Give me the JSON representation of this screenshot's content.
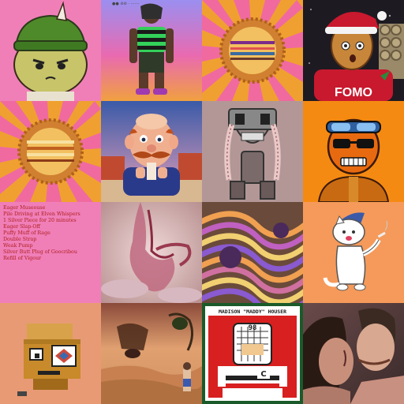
{
  "tiles": [
    {
      "id": 1,
      "subject": "green-beanie-unicorn-cat-icon"
    },
    {
      "id": 2,
      "subject": "striped-figure-icon",
      "caption": "●● ⊘⊘ · ·······"
    },
    {
      "id": 3,
      "subject": "sunburst-coin-icon"
    },
    {
      "id": 4,
      "subject": "gingerbread-santa-fomo-icon",
      "shirt_text": "FOMO"
    },
    {
      "id": 5,
      "subject": "sunburst-coin-icon"
    },
    {
      "id": 6,
      "subject": "chef-mustache-icon"
    },
    {
      "id": 7,
      "subject": "robot-creature-icon"
    },
    {
      "id": 8,
      "subject": "goggles-robot-icon"
    },
    {
      "id": 9,
      "subject": "text-list",
      "lines": [
        "Eager Museouse",
        "Pile Driving at Elven Whispers",
        "1 Silver Piece for 20 minutes",
        "Eager Slap-Off",
        "Puffy Muff of Rage",
        "Double Strap",
        "Weak Pump",
        "Silver Butt Plug of Goocribou",
        "Refill of Vigour"
      ]
    },
    {
      "id": 10,
      "subject": "abstract-pink-hand-icon"
    },
    {
      "id": 11,
      "subject": "psychedelic-swirl-icon"
    },
    {
      "id": 12,
      "subject": "white-cat-wizard-icon"
    },
    {
      "id": 13,
      "subject": "pixel-box-robot-icon"
    },
    {
      "id": 14,
      "subject": "desert-scene-icon"
    },
    {
      "id": 15,
      "subject": "hockey-card-icon",
      "header": "MADISON \"MADDY\" HOUSER",
      "number": "98",
      "jersey_letter": "C"
    },
    {
      "id": 16,
      "subject": "couple-portrait-icon"
    }
  ],
  "colors": {
    "pink": "#f07fb8",
    "orange": "#f59a2a",
    "red": "#d02020",
    "peach": "#e89a74"
  }
}
